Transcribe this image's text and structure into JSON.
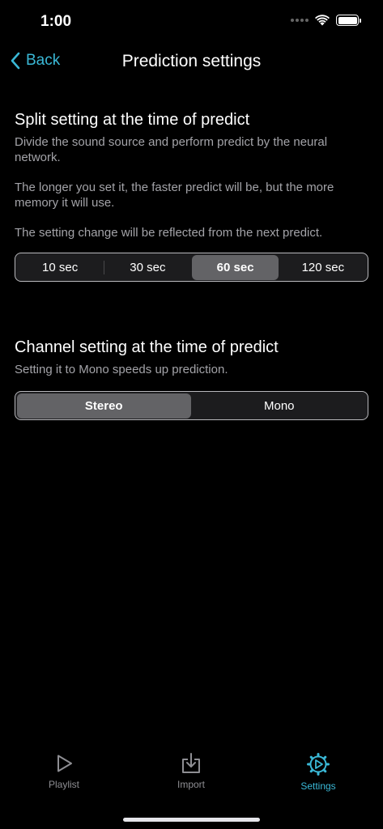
{
  "status_bar": {
    "time": "1:00"
  },
  "nav": {
    "back_label": "Back",
    "title": "Prediction settings"
  },
  "split_section": {
    "title": "Split setting at the time of predict",
    "desc1": "Divide the sound source and perform predict by the neural network.",
    "desc2": "The longer you set it, the faster predict will be, but the more memory it will use.",
    "desc3": "The setting change will be reflected from the next predict.",
    "options": [
      "10 sec",
      "30 sec",
      "60 sec",
      "120 sec"
    ],
    "selected": "60 sec"
  },
  "channel_section": {
    "title": "Channel setting at the time of predict",
    "desc": "Setting it to Mono speeds up prediction.",
    "options": [
      "Stereo",
      "Mono"
    ],
    "selected": "Stereo"
  },
  "tab_bar": {
    "items": [
      {
        "label": "Playlist",
        "icon": "play-icon",
        "active": false
      },
      {
        "label": "Import",
        "icon": "import-icon",
        "active": false
      },
      {
        "label": "Settings",
        "icon": "settings-icon",
        "active": true
      }
    ]
  },
  "colors": {
    "accent": "#3ab8d6",
    "background": "#000000",
    "secondary_text": "#a3a3a8"
  }
}
